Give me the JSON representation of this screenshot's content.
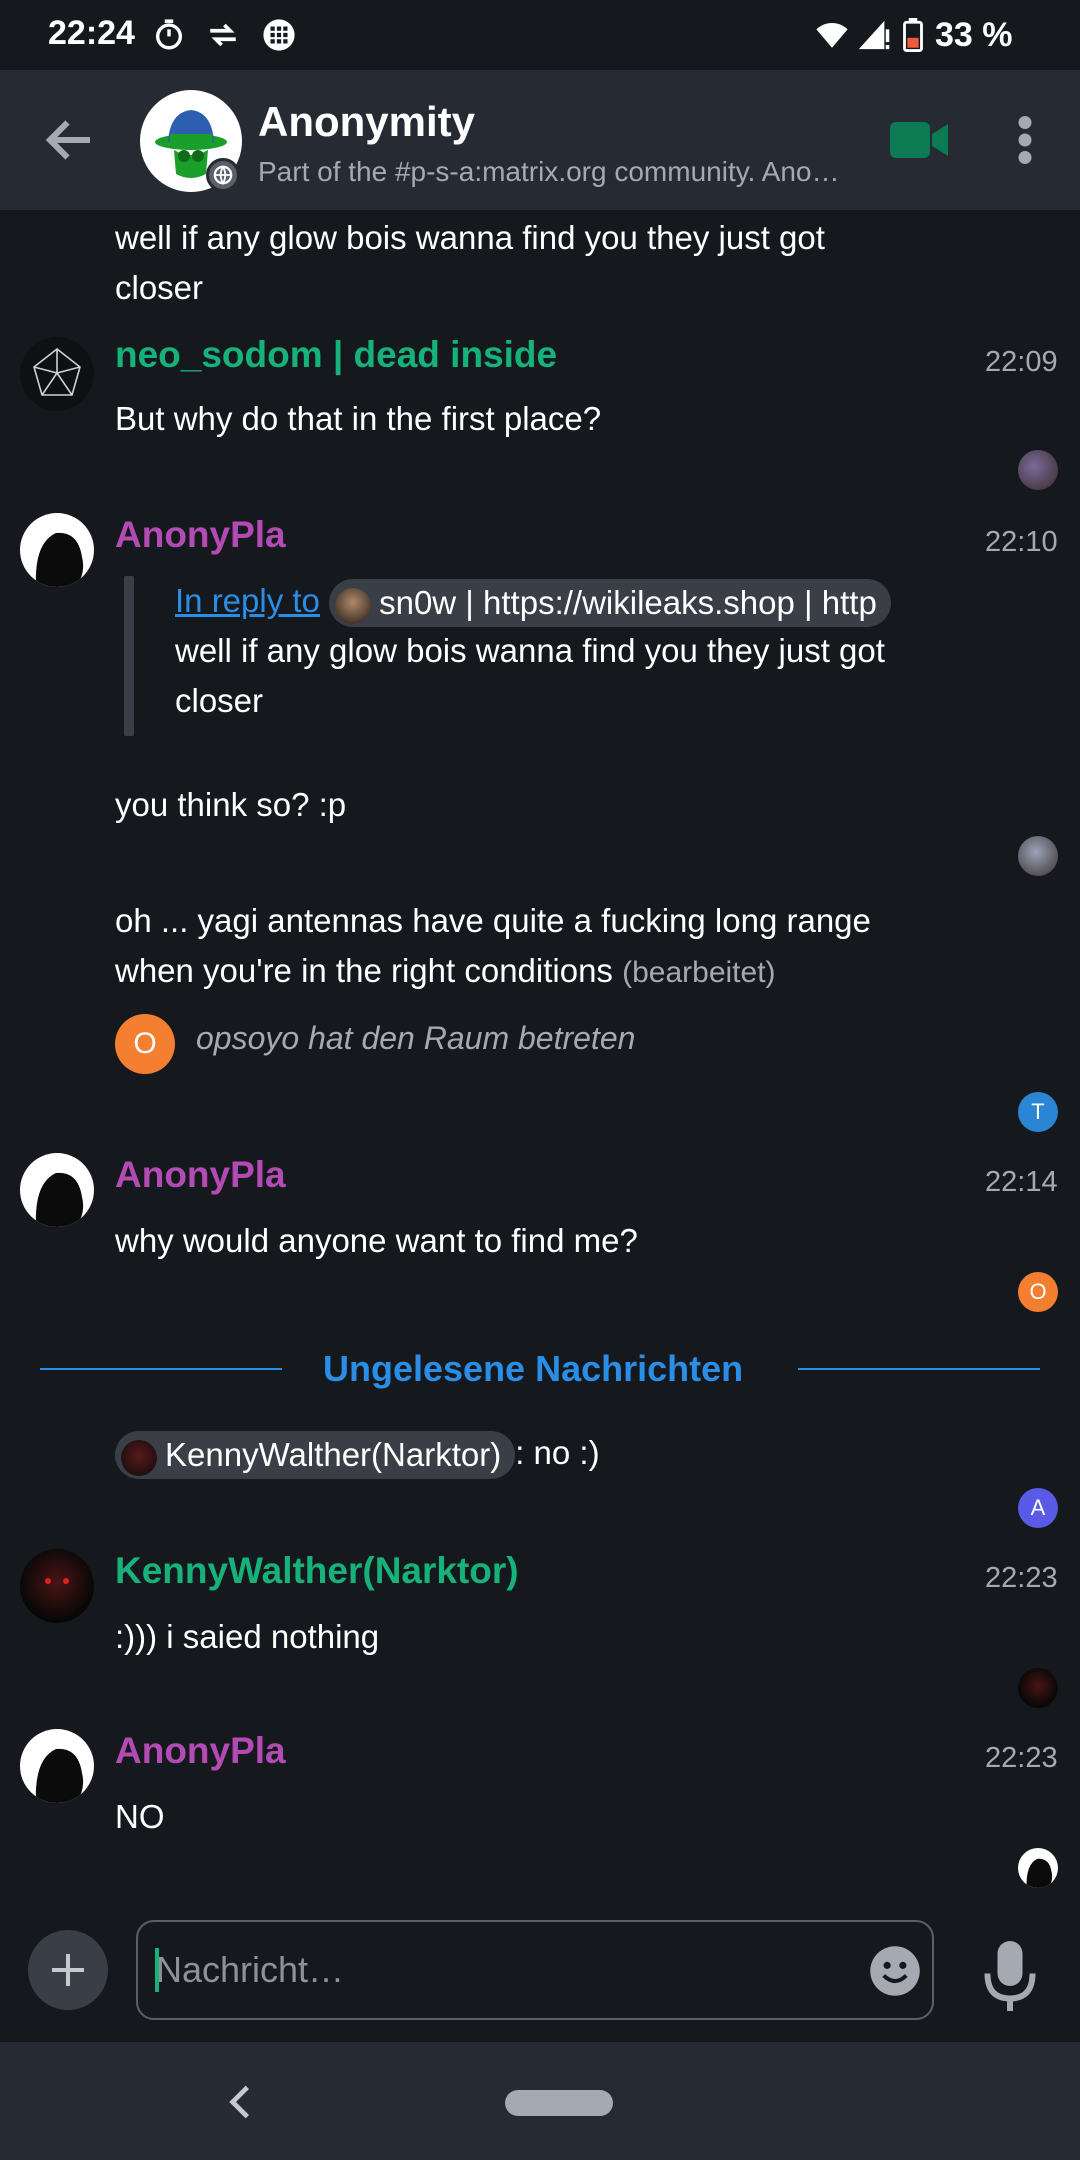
{
  "status_bar": {
    "time": "22:24",
    "battery": "33 %"
  },
  "room": {
    "title": "Anonymity",
    "topic": "Part of the #p-s-a:matrix.org community. Anonymity and privacy discussion."
  },
  "messages": {
    "m0": {
      "text": "well if any glow bois wanna find you they just got closer"
    },
    "m1": {
      "sender": "neo_sodom | dead inside",
      "time": "22:09",
      "text": "But why do that in the first place?"
    },
    "m2": {
      "sender": "AnonyPla",
      "time": "22:10",
      "reply_link": "In reply to",
      "reply_user": "sn0w | https://wikileaks.shop | http",
      "reply_text": "well if any glow bois wanna find you they just got closer",
      "text": "you think so? :p"
    },
    "m3": {
      "text": "oh ... yagi antennas have quite a fucking long range when you're in the right conditions",
      "edited": "(bearbeitet)"
    },
    "event": {
      "avatar_letter": "O",
      "text": "opsoyo hat den Raum betreten"
    },
    "m4": {
      "sender": "AnonyPla",
      "time": "22:14",
      "text": "why would anyone want to find me?"
    },
    "unread_label": "Ungelesene Nachrichten",
    "m5": {
      "mention": "KennyWalther(Narktor)",
      "text": ": no :)"
    },
    "m6": {
      "sender": "KennyWalther(Narktor)",
      "time": "22:23",
      "text": ":))) i saied nothing"
    },
    "m7": {
      "sender": "AnonyPla",
      "time": "22:23",
      "text": "NO"
    }
  },
  "read_receipts": {
    "t": "T",
    "o": "O",
    "a": "A"
  },
  "composer": {
    "placeholder": "Nachricht…"
  },
  "colors": {
    "accent_green": "#17b27a",
    "accent_purple": "#b44bb4",
    "link_blue": "#2a8de6",
    "background": "#15191e"
  },
  "icons": [
    "arrow-left-icon",
    "globe-icon",
    "video-camera-icon",
    "more-vert-icon",
    "plus-icon",
    "smiley-icon",
    "microphone-icon",
    "nav-back-icon"
  ]
}
